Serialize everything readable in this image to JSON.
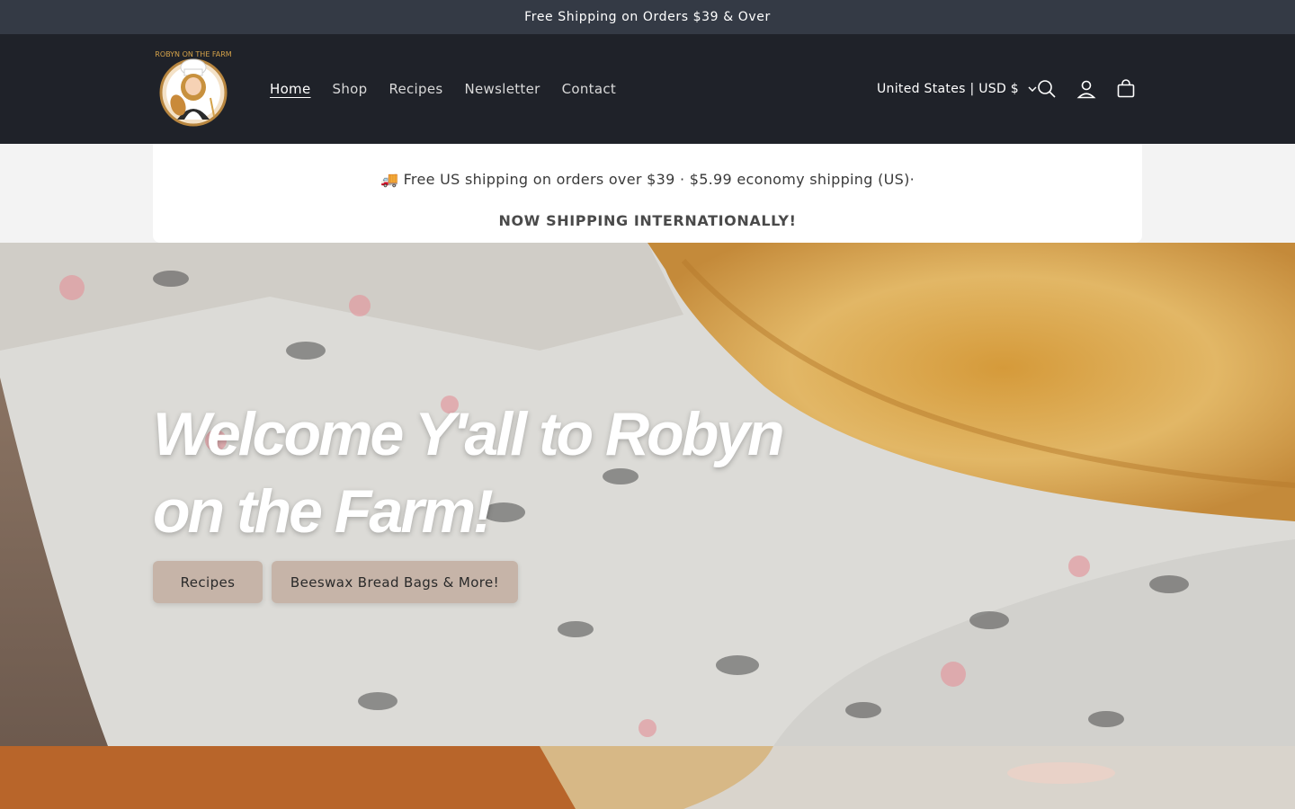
{
  "announcement": {
    "text": "Free Shipping on Orders $39 & Over"
  },
  "header": {
    "logo_text": "ROBYN ON THE FARM",
    "nav": [
      {
        "label": "Home",
        "active": true
      },
      {
        "label": "Shop"
      },
      {
        "label": "Recipes"
      },
      {
        "label": "Newsletter"
      },
      {
        "label": "Contact"
      }
    ],
    "country_selector": "United States | USD $",
    "icons": [
      "search-icon",
      "account-icon",
      "cart-icon"
    ]
  },
  "shipping_banner": {
    "line1": "🚚 Free US shipping on orders over $39 · $5.99 economy shipping (US)·",
    "line2": "NOW SHIPPING INTERNATIONALLY!"
  },
  "hero": {
    "title_line1": "Welcome Y'all to Robyn",
    "title_line2": "on the Farm!",
    "buttons": [
      {
        "label": "Recipes"
      },
      {
        "label": "Beeswax Bread Bags & More!"
      }
    ]
  },
  "colors": {
    "announcement_bg": "#343a45",
    "header_bg": "#1f2229",
    "button_bg": "#c6b4a8"
  }
}
